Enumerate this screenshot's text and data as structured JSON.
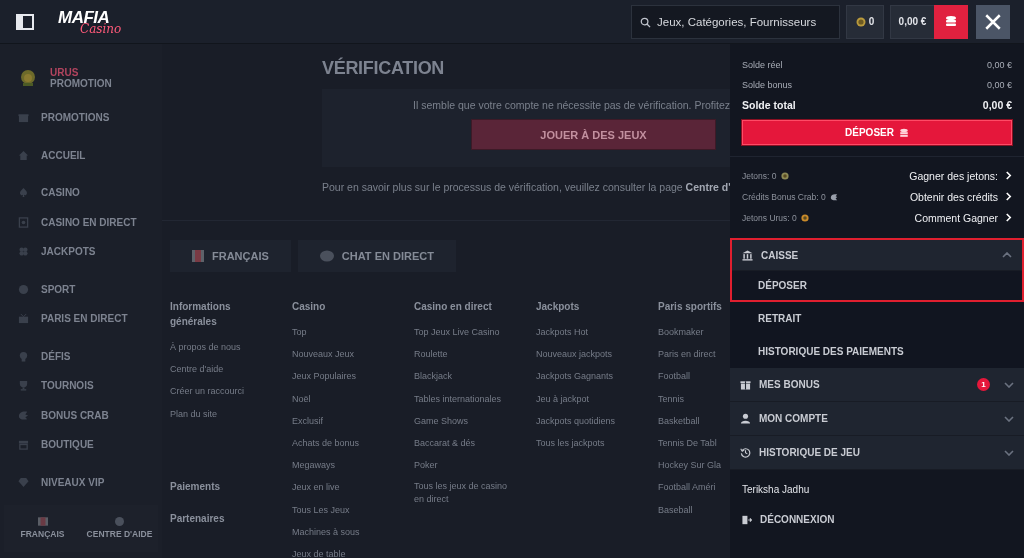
{
  "header": {
    "logo": {
      "line1": "MAFIA",
      "line2": "Casino"
    },
    "search": {
      "placeholder": "Jeux, Catégories, Fournisseurs"
    },
    "coins": "0",
    "balance": "0,00 €"
  },
  "sidebar": {
    "promo": {
      "title": "URUS",
      "subtitle": "PROMOTION"
    },
    "groups": [
      [
        {
          "label": "PROMOTIONS"
        }
      ],
      [
        {
          "label": "ACCUEIL"
        }
      ],
      [
        {
          "label": "CASINO"
        },
        {
          "label": "CASINO EN DIRECT"
        },
        {
          "label": "JACKPOTS"
        }
      ],
      [
        {
          "label": "SPORT"
        },
        {
          "label": "PARIS EN DIRECT"
        }
      ],
      [
        {
          "label": "DÉFIS"
        },
        {
          "label": "TOURNOIS"
        },
        {
          "label": "BONUS CRAB"
        },
        {
          "label": "BOUTIQUE"
        }
      ],
      [
        {
          "label": "NIVEAUX VIP"
        }
      ]
    ],
    "footer": [
      {
        "label": "FRANÇAIS",
        "kind": "flag"
      },
      {
        "label": "CENTRE D'AIDE",
        "kind": "help"
      }
    ]
  },
  "main": {
    "title": "VÉRIFICATION",
    "notice": "Il semble que votre compte ne nécessite pas de vérification. Profitez",
    "play_button": "JOUER À DES JEUX",
    "info": "Pour en savoir plus sur le processus de vérification, veuillez consulter la page **Centre d'**",
    "lang_buttons": [
      {
        "label": "FRANÇAIS",
        "kind": "flag"
      },
      {
        "label": "CHAT EN DIRECT",
        "kind": "chat"
      }
    ],
    "footer_columns": [
      {
        "title": "Informations générales",
        "links": [
          "À propos de nous",
          "Centre d'aide",
          "Créer un raccourci",
          "Plan du site"
        ],
        "more": [
          "Paiements",
          "Partenaires"
        ]
      },
      {
        "title": "Casino",
        "links": [
          "Top",
          "Nouveaux Jeux",
          "Jeux Populaires",
          "Noël",
          "Exclusif",
          "Achats de bonus",
          "Megaways",
          "Jeux en live",
          "Tous Les Jeux",
          "Machines à sous",
          "Jeux de table"
        ]
      },
      {
        "title": "Casino en direct",
        "links": [
          "Top Jeux Live Casino",
          "Roulette",
          "Blackjack",
          "Tables internationales",
          "Game Shows",
          "Baccarat & dés",
          "Poker",
          "Tous les jeux de casino en direct"
        ]
      },
      {
        "title": "Jackpots",
        "links": [
          "Jackpots Hot",
          "Nouveaux jackpots",
          "Jackpots Gagnants",
          "Jeu à jackpot",
          "Jackpots quotidiens",
          "Tous les jackpots"
        ]
      },
      {
        "title": "Paris sportifs",
        "links": [
          "Bookmaker",
          "Paris en direct",
          "Football",
          "Tennis",
          "Basketball",
          "Tennis De Tabl",
          "Hockey Sur Gla",
          "Football Améri",
          "Baseball"
        ]
      }
    ]
  },
  "panel": {
    "balances": [
      {
        "label": "Solde réel",
        "value": "0,00 €",
        "kind": "plain"
      },
      {
        "label": "Solde bonus",
        "value": "0,00 €",
        "kind": "plain"
      },
      {
        "label": "Solde total",
        "value": "0,00 €",
        "kind": "total"
      }
    ],
    "deposit_button": "DÉPOSER",
    "tokens": [
      {
        "label": "Jetons: 0",
        "kind": "coin",
        "link": "Gagner des jetons:"
      },
      {
        "label": "Crédits Bonus Crab: 0",
        "kind": "crab",
        "link": "Obtenir des crédits"
      },
      {
        "label": "Jetons Urus: 0",
        "kind": "urus",
        "link": "Comment Gagner"
      }
    ],
    "sections": [
      {
        "label": "CAISSE",
        "kind": "bank",
        "expanded": true,
        "highlighted": true,
        "children": [
          {
            "label": "DÉPOSER"
          },
          {
            "label": "RETRAIT"
          },
          {
            "label": "HISTORIQUE DES PAIEMENTS"
          }
        ]
      },
      {
        "label": "MES BONUS",
        "kind": "gift",
        "expanded": false,
        "badge": "1"
      },
      {
        "label": "MON COMPTE",
        "kind": "user",
        "expanded": false
      },
      {
        "label": "HISTORIQUE DE JEU",
        "kind": "history",
        "expanded": false
      }
    ],
    "user": {
      "name": "Teriksha Jadhu"
    },
    "logout": "DÉCONNEXION"
  }
}
